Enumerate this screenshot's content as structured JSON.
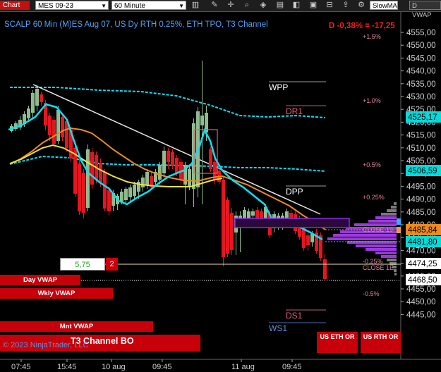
{
  "toolbar": {
    "tab_label": "Chart",
    "instrument": "MES 09-23",
    "interval": "60 Minute",
    "icons": [
      "bar-type-icon",
      "draw-tools-icon",
      "crosshair-icon",
      "zoom-icon",
      "properties-icon",
      "strategy-icon",
      "tile-icon",
      "screenshot-icon",
      "trader-icon"
    ],
    "slowma_label": "SlowMA",
    "dvwap_label": "D VWAP"
  },
  "header": {
    "title": "SCALP 60 Min (M)ES Aug 07, US Dy RTH 0.25%, ETH TPO, T3 Channel",
    "pnl": "D -0,38% = -17,25"
  },
  "price_axis": {
    "ticks": [
      "4555,00",
      "4550,00",
      "4545,00",
      "4540,00",
      "4535,00",
      "4530,00",
      "4525,00",
      "4520,00",
      "4515,00",
      "4510,00",
      "4505,00",
      "4500,00",
      "4495,00",
      "4490,00",
      "4485,00",
      "4480,00",
      "4475,00",
      "4470,00",
      "4465,00",
      "4460,00",
      "4455,00",
      "4450,00",
      "4445,00"
    ],
    "markers": [
      {
        "text": "4525,17",
        "bg": "#00dcdc",
        "fg": "#000000"
      },
      {
        "text": "4506,59",
        "bg": "#00dcdc",
        "fg": "#000000"
      },
      {
        "text": "4485,84",
        "bg": "#f08a1c",
        "fg": "#000000"
      },
      {
        "text": "4481,80",
        "bg": "#00dcdc",
        "fg": "#000000"
      },
      {
        "text": "4474,25",
        "bg": "#ffffff",
        "fg": "#000000"
      },
      {
        "text": "4468,50",
        "bg": "#ffffff",
        "fg": "#000000"
      }
    ]
  },
  "time_axis": {
    "labels": [
      "07:45",
      "15:45",
      "10 aug",
      "09:45",
      "11 aug",
      "09:45"
    ]
  },
  "levels": {
    "wpp": "WPP",
    "dr1": "DR1",
    "dpp": "DPP",
    "ds1": "DS1",
    "ws1": "WS1",
    "pct_labels": [
      "+1.5%",
      "+1.0%",
      "+0.5%",
      "+0.25%",
      "-0.25%",
      "-0.5%"
    ],
    "close_labels": [
      "CLOSE 19",
      "CLOSE 1E"
    ]
  },
  "order_entry": {
    "value": "5,75",
    "quantity": "2"
  },
  "vwap_buttons": [
    "Day VWAP",
    "Wkly VWAP",
    "Mnt VWAP"
  ],
  "t3_label": "T3 Channel BO",
  "copyright": "© 2023 NinjaTrader, LLC",
  "or_buttons": [
    "US ETH OR",
    "US RTH OR"
  ],
  "colors": {
    "bull": "#8fbc8f",
    "bear": "#e8141e",
    "cyan": "#00e5ff",
    "orange": "#f08a1c",
    "yellow": "#f0e040",
    "purple": "#8a2be2",
    "gray": "#8a8a8a"
  }
}
